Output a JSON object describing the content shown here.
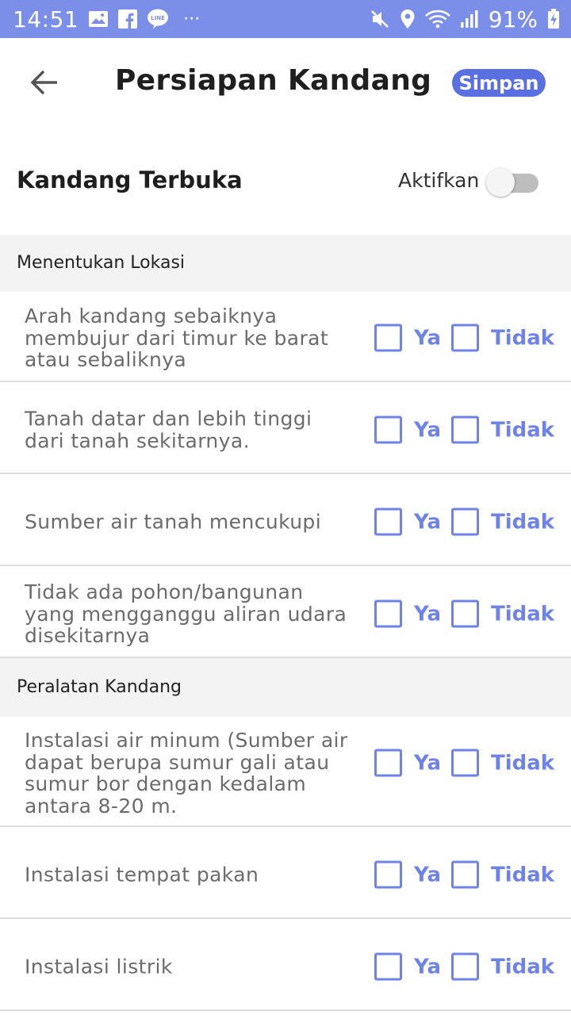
{
  "status_bar": {
    "time": "14:51",
    "battery": "91%",
    "more_dots": "···",
    "icons_left": [
      "image-icon",
      "facebook-icon",
      "line-icon",
      "more-icon"
    ],
    "icons_right": [
      "mute-icon",
      "location-icon",
      "wifi-icon",
      "signal-icon",
      "battery-charging-icon"
    ]
  },
  "app_bar": {
    "title": "Persiapan Kandang",
    "save_label": "Simpan",
    "back_icon": "arrow-back-icon",
    "accent_color": "#5a6fe0"
  },
  "section": {
    "title": "Kandang Terbuka",
    "toggle_label": "Aktifkan",
    "toggle_on": false
  },
  "options": {
    "yes": "Ya",
    "no": "Tidak"
  },
  "groups": [
    {
      "title": "Menentukan Lokasi",
      "items": [
        {
          "label": "Arah kandang sebaiknya membujur dari timur ke barat atau sebaliknya",
          "ya": false,
          "tidak": false
        },
        {
          "label": "Tanah datar dan lebih tinggi dari tanah sekitarnya.",
          "ya": false,
          "tidak": false
        },
        {
          "label": "Sumber air tanah mencukupi",
          "ya": false,
          "tidak": false
        },
        {
          "label": "Tidak ada pohon/bangunan yang mengganggu aliran udara disekitarnya",
          "ya": false,
          "tidak": false
        }
      ]
    },
    {
      "title": "Peralatan Kandang",
      "items": [
        {
          "label": "Instalasi air minum (Sumber air dapat berupa sumur gali atau sumur bor dengan kedalam antara 8-20 m.",
          "ya": false,
          "tidak": false
        },
        {
          "label": "Instalasi tempat pakan",
          "ya": false,
          "tidak": false
        },
        {
          "label": "Instalasi listrik",
          "ya": false,
          "tidak": false
        }
      ]
    }
  ]
}
